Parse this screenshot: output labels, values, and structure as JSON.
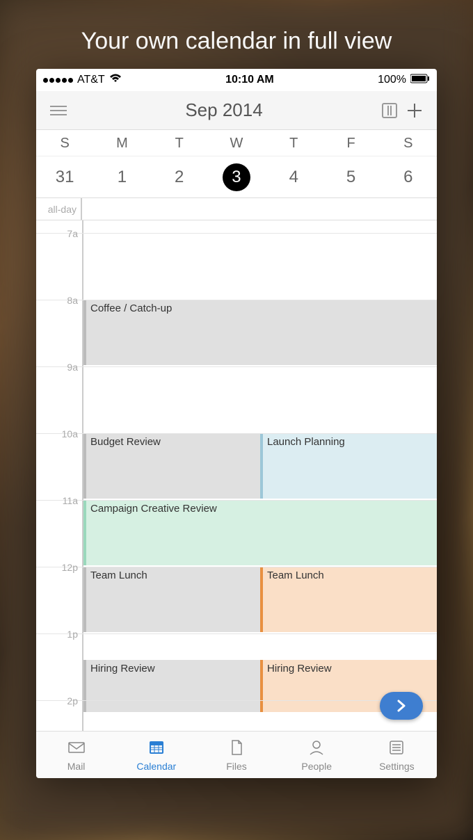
{
  "headline": "Your own calendar in full view",
  "status": {
    "carrier": "AT&T",
    "time": "10:10 AM",
    "battery": "100%"
  },
  "nav": {
    "title": "Sep 2014"
  },
  "week": {
    "days": [
      "S",
      "M",
      "T",
      "W",
      "T",
      "F",
      "S"
    ],
    "dates": [
      "31",
      "1",
      "2",
      "3",
      "4",
      "5",
      "6"
    ],
    "selected_index": 3
  },
  "allday_label": "all-day",
  "hours": [
    "7a",
    "8a",
    "9a",
    "10a",
    "11a",
    "12p",
    "1p",
    "2p"
  ],
  "hour_height": 96,
  "events": [
    {
      "title": "Coffee / Catch-up",
      "start_idx": 1,
      "end_idx": 2,
      "col": 0,
      "cols": 1,
      "bg": "#e0e0e0",
      "border": "#bbb"
    },
    {
      "title": "Budget Review",
      "start_idx": 3,
      "end_idx": 4,
      "col": 0,
      "cols": 2,
      "bg": "#e0e0e0",
      "border": "#bbb"
    },
    {
      "title": "Launch Planning",
      "start_idx": 3,
      "end_idx": 4,
      "col": 1,
      "cols": 2,
      "bg": "#dcedf2",
      "border": "#9cc7d8"
    },
    {
      "title": "Campaign Creative Review",
      "start_idx": 4,
      "end_idx": 5,
      "col": 0,
      "cols": 1,
      "bg": "#d6f0e2",
      "border": "#9ad8bc"
    },
    {
      "title": "Team Lunch",
      "start_idx": 5,
      "end_idx": 6,
      "col": 0,
      "cols": 2,
      "bg": "#e0e0e0",
      "border": "#bbb"
    },
    {
      "title": "Team Lunch",
      "start_idx": 5,
      "end_idx": 6,
      "col": 1,
      "cols": 2,
      "bg": "#fadfc7",
      "border": "#e89040"
    },
    {
      "title": "Hiring Review",
      "start_idx": 6.4,
      "end_idx": 7.2,
      "col": 0,
      "cols": 2,
      "bg": "#e0e0e0",
      "border": "#bbb"
    },
    {
      "title": "Hiring Review",
      "start_idx": 6.4,
      "end_idx": 7.2,
      "col": 1,
      "cols": 2,
      "bg": "#fadfc7",
      "border": "#e89040"
    }
  ],
  "tabs": [
    {
      "id": "mail",
      "label": "Mail",
      "active": false
    },
    {
      "id": "calendar",
      "label": "Calendar",
      "active": true
    },
    {
      "id": "files",
      "label": "Files",
      "active": false
    },
    {
      "id": "people",
      "label": "People",
      "active": false
    },
    {
      "id": "settings",
      "label": "Settings",
      "active": false
    }
  ]
}
